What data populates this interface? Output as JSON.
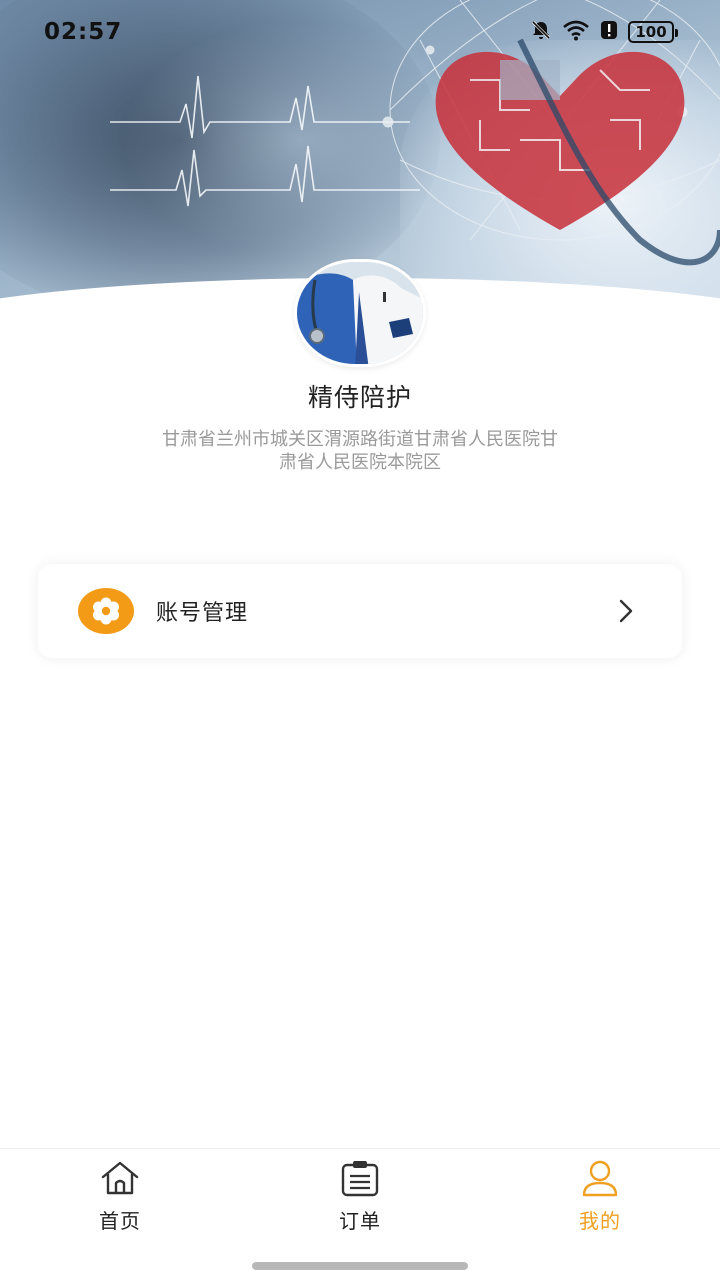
{
  "status_bar": {
    "time": "02:57",
    "battery": "100",
    "icons": [
      "bell-muted-icon",
      "wifi-icon",
      "alert-icon",
      "battery-icon"
    ]
  },
  "header": {
    "banner_icons": [
      "heartbeat-line",
      "circuit-heart",
      "stethoscope"
    ]
  },
  "profile": {
    "name": "精侍陪护",
    "address": "甘肃省兰州市城关区渭源路街道甘肃省人民医院甘肃省人民医院本院区"
  },
  "menu": {
    "items": [
      {
        "label": "账号管理",
        "icon": "settings-flower-icon",
        "arrow": "chevron-right-icon"
      }
    ]
  },
  "nav": {
    "items": [
      {
        "label": "首页",
        "icon": "home-icon",
        "active": false
      },
      {
        "label": "订单",
        "icon": "clipboard-icon",
        "active": false
      },
      {
        "label": "我的",
        "icon": "user-icon",
        "active": true
      }
    ]
  },
  "colors": {
    "accent": "#f0a020",
    "menu_icon_bg": "#f39a16",
    "text_primary": "#222222",
    "text_secondary": "#9a9a9a"
  }
}
